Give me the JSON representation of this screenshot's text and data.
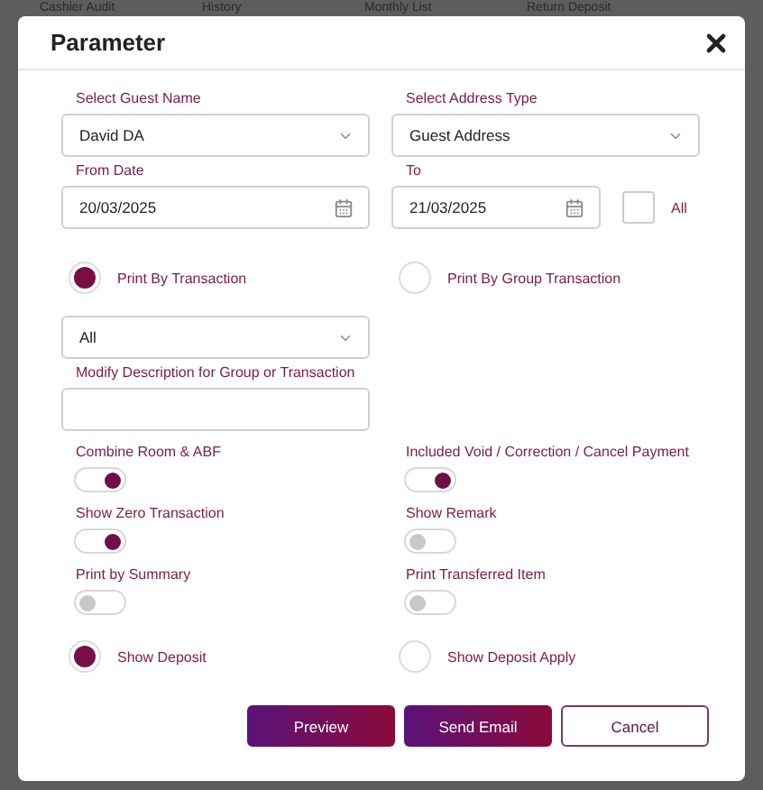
{
  "background_tabs": [
    "Cashier Audit",
    "History",
    "Monthly List",
    "Return Deposit"
  ],
  "dialog": {
    "title": "Parameter",
    "guest_name": {
      "label": "Select Guest Name",
      "value": "David DA"
    },
    "address_type": {
      "label": "Select Address Type",
      "value": "Guest Address"
    },
    "from_date": {
      "label": "From Date",
      "value": "20/03/2025"
    },
    "to_date": {
      "label": "To",
      "value": "21/03/2025"
    },
    "all_dates": {
      "label": "All",
      "checked": false
    },
    "print_mode": [
      {
        "label": "Print By Transaction",
        "selected": true
      },
      {
        "label": "Print By Group Transaction",
        "selected": false
      }
    ],
    "group_filter": {
      "value": "All"
    },
    "description": {
      "label": "Modify Description for Group or Transaction"
    },
    "toggles": [
      {
        "label": "Combine Room & ABF",
        "on": true
      },
      {
        "label": "Included Void / Correction / Cancel Payment",
        "on": true
      },
      {
        "label": "Show Zero Transaction",
        "on": true
      },
      {
        "label": "Show Remark",
        "on": false
      },
      {
        "label": "Print by Summary",
        "on": false
      },
      {
        "label": "Print Transferred Item",
        "on": false
      }
    ],
    "deposit_options": [
      {
        "label": "Show Deposit",
        "selected": true
      },
      {
        "label": "Show Deposit Apply",
        "selected": false
      }
    ],
    "buttons": [
      {
        "label": "Preview",
        "kind": "primary"
      },
      {
        "label": "Send Email",
        "kind": "primary"
      },
      {
        "label": "Cancel",
        "kind": "outline"
      }
    ]
  }
}
